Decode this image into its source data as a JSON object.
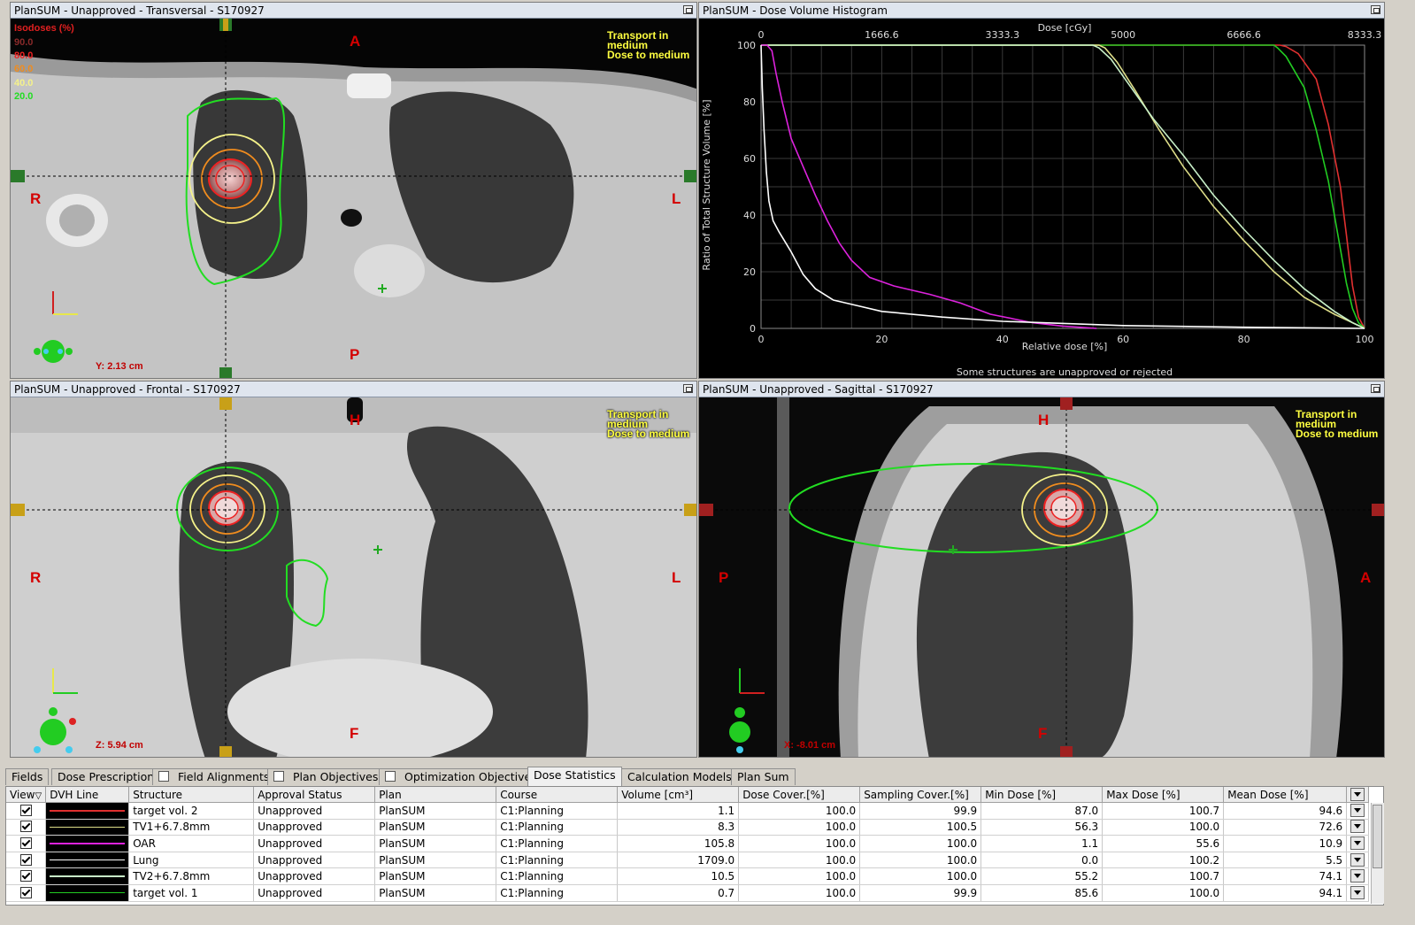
{
  "panes": {
    "transversal": {
      "title": "PlanSUM  -  Unapproved - Transversal - S170927",
      "orient": {
        "top": "A",
        "bottom": "P",
        "left": "R",
        "right": "L"
      },
      "coord": "Y: 2.13 cm",
      "transport": [
        "Transport in",
        "medium",
        "Dose to medium"
      ],
      "isodoses": {
        "title": "Isodoses (%)",
        "levels": [
          {
            "label": "90.0",
            "color": "#8b2a2a"
          },
          {
            "label": "80.0",
            "color": "#ee2222"
          },
          {
            "label": "60.0",
            "color": "#f08c1e"
          },
          {
            "label": "40.0",
            "color": "#f5f28a"
          },
          {
            "label": "20.0",
            "color": "#22dd22"
          }
        ]
      }
    },
    "dvh": {
      "title": "PlanSUM - Dose Volume Histogram",
      "footer": "Some structures are unapproved or rejected"
    },
    "frontal": {
      "title": "PlanSUM  -  Unapproved - Frontal - S170927",
      "orient": {
        "top": "H",
        "bottom": "F",
        "left": "R",
        "right": "L"
      },
      "coord": "Z: 5.94 cm",
      "transport": [
        "Transport in",
        "medium",
        "Dose to medium"
      ]
    },
    "sagittal": {
      "title": "PlanSUM  -  Unapproved - Sagittal - S170927",
      "orient": {
        "top": "H",
        "bottom": "F",
        "left": "P",
        "right": "A"
      },
      "coord": "X: -8.01 cm",
      "transport": [
        "Transport in",
        "medium",
        "Dose to medium"
      ]
    }
  },
  "chart_data": {
    "type": "line",
    "title": "",
    "xlabel": "Relative dose [%]",
    "x2label": "Dose [cGy]",
    "ylabel": "Ratio of Total Structure Volume [%]",
    "xlim": [
      0,
      100
    ],
    "ylim": [
      0,
      100
    ],
    "xticks": [
      0,
      20,
      40,
      60,
      80,
      100
    ],
    "x2ticks": [
      "0",
      "1666.6",
      "3333.3",
      "5000",
      "6666.6",
      "8333.3"
    ],
    "yticks": [
      0,
      20,
      40,
      60,
      80,
      100
    ],
    "grid": true,
    "series": [
      {
        "name": "target vol. 2",
        "color": "#e03030",
        "x": [
          0,
          86,
          87,
          89,
          92,
          94,
          96,
          97,
          98,
          99,
          100
        ],
        "y": [
          100,
          100,
          99.5,
          97,
          88,
          72,
          50,
          33,
          15,
          4,
          0
        ]
      },
      {
        "name": "target vol. 1",
        "color": "#22cc22",
        "x": [
          0,
          85,
          85.6,
          87,
          90,
          92,
          94,
          95,
          96,
          97,
          98,
          99,
          100
        ],
        "y": [
          100,
          100,
          99,
          96,
          85,
          70,
          52,
          40,
          28,
          16,
          7,
          2,
          0
        ]
      },
      {
        "name": "TV1+6.7.8mm",
        "color": "#dddd88",
        "x": [
          0,
          56,
          57,
          59,
          62,
          66,
          70,
          75,
          80,
          85,
          90,
          95,
          98,
          100
        ],
        "y": [
          100,
          100,
          99,
          94,
          84,
          70,
          57,
          43,
          31,
          20,
          11,
          5,
          2,
          0
        ]
      },
      {
        "name": "TV2+6.7.8mm",
        "color": "#c8f0c8",
        "x": [
          0,
          55,
          56,
          58,
          61,
          65,
          70,
          75,
          80,
          85,
          90,
          95,
          98,
          100
        ],
        "y": [
          100,
          100,
          99,
          95,
          86,
          74,
          61,
          47,
          35,
          24,
          14,
          6,
          2,
          0
        ]
      },
      {
        "name": "OAR",
        "color": "#dd22dd",
        "x": [
          0,
          1,
          1.8,
          2.5,
          3.5,
          5,
          7,
          9,
          11,
          13,
          15,
          18,
          22,
          28,
          33,
          38,
          45,
          50,
          55.6
        ],
        "y": [
          100,
          100,
          98,
          90,
          80,
          67,
          57,
          47,
          38,
          30,
          24,
          18,
          15,
          12,
          9,
          5,
          2,
          0.8,
          0
        ]
      },
      {
        "name": "Lung",
        "color": "#ffffff",
        "x": [
          0,
          0.2,
          0.5,
          0.9,
          1.3,
          2,
          3,
          5,
          7,
          9,
          12,
          16,
          20,
          30,
          40,
          60,
          80,
          100
        ],
        "y": [
          100,
          85,
          70,
          55,
          45,
          38,
          34,
          27,
          19,
          14,
          10,
          8,
          6,
          4,
          2.5,
          1,
          0.4,
          0
        ]
      }
    ]
  },
  "tabs": [
    {
      "label": "Fields",
      "checkbox": false,
      "active": false
    },
    {
      "label": "Dose Prescription",
      "checkbox": false,
      "active": false
    },
    {
      "label": "Field Alignments",
      "checkbox": true,
      "active": false
    },
    {
      "label": "Plan Objectives",
      "checkbox": true,
      "active": false
    },
    {
      "label": "Optimization Objectives",
      "checkbox": true,
      "active": false
    },
    {
      "label": "Dose Statistics",
      "checkbox": false,
      "active": true
    },
    {
      "label": "Calculation Models",
      "checkbox": false,
      "active": false
    },
    {
      "label": "Plan Sum",
      "checkbox": false,
      "active": false
    }
  ],
  "table": {
    "columns": [
      "View",
      "DVH Line",
      "Structure",
      "Approval Status",
      "Plan",
      "Course",
      "Volume [cm³]",
      "Dose Cover.[%]",
      "Sampling Cover.[%]",
      "Min Dose [%]",
      "Max Dose [%]",
      "Mean Dose [%]"
    ],
    "rows": [
      {
        "line": "#e03030",
        "structure": "target vol. 2",
        "approval": "Unapproved",
        "plan": "PlanSUM",
        "course": "C1:Planning",
        "volume": "1.1",
        "dose_cover": "100.0",
        "sampling": "99.9",
        "min": "87.0",
        "max": "100.7",
        "mean": "94.6"
      },
      {
        "line": "#dddd88",
        "structure": "TV1+6.7.8mm",
        "approval": "Unapproved",
        "plan": "PlanSUM",
        "course": "C1:Planning",
        "volume": "8.3",
        "dose_cover": "100.0",
        "sampling": "100.5",
        "min": "56.3",
        "max": "100.0",
        "mean": "72.6"
      },
      {
        "line": "#dd22dd",
        "structure": "OAR",
        "approval": "Unapproved",
        "plan": "PlanSUM",
        "course": "C1:Planning",
        "volume": "105.8",
        "dose_cover": "100.0",
        "sampling": "100.0",
        "min": "1.1",
        "max": "55.6",
        "mean": "10.9"
      },
      {
        "line": "#ffffff",
        "structure": "Lung",
        "approval": "Unapproved",
        "plan": "PlanSUM",
        "course": "C1:Planning",
        "volume": "1709.0",
        "dose_cover": "100.0",
        "sampling": "100.0",
        "min": "0.0",
        "max": "100.2",
        "mean": "5.5"
      },
      {
        "line": "#c8f0c8",
        "structure": "TV2+6.7.8mm",
        "approval": "Unapproved",
        "plan": "PlanSUM",
        "course": "C1:Planning",
        "volume": "10.5",
        "dose_cover": "100.0",
        "sampling": "100.0",
        "min": "55.2",
        "max": "100.7",
        "mean": "74.1"
      },
      {
        "line": "#22cc22",
        "structure": "target vol. 1",
        "approval": "Unapproved",
        "plan": "PlanSUM",
        "course": "C1:Planning",
        "volume": "0.7",
        "dose_cover": "100.0",
        "sampling": "99.9",
        "min": "85.6",
        "max": "100.0",
        "mean": "94.1"
      }
    ]
  }
}
